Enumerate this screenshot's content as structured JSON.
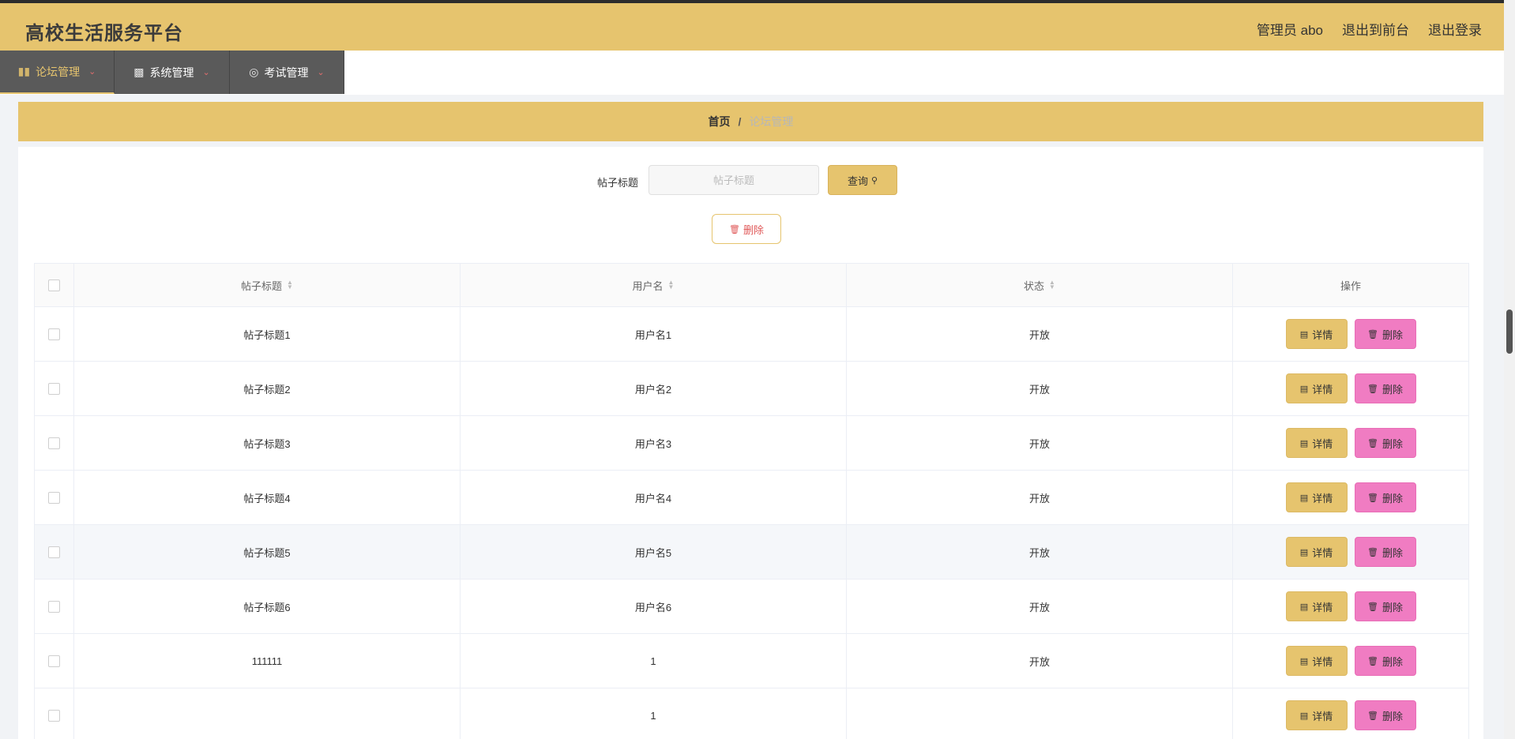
{
  "header": {
    "title": "高校生活服务平台",
    "admin_label": "管理员 abo",
    "to_front": "退出到前台",
    "logout": "退出登录"
  },
  "menu": [
    {
      "label": "论坛管理",
      "icon": "bar-list-icon",
      "active": true
    },
    {
      "label": "系统管理",
      "icon": "bar-chart-icon",
      "active": false
    },
    {
      "label": "考试管理",
      "icon": "compass-icon",
      "active": false
    }
  ],
  "breadcrumb": {
    "home": "首页",
    "separator": "/",
    "current": "论坛管理"
  },
  "search": {
    "label": "帖子标题",
    "placeholder": "帖子标题",
    "value": "",
    "button": "查询"
  },
  "bulk_delete_label": "删除",
  "table": {
    "columns": [
      "帖子标题",
      "用户名",
      "状态",
      "操作"
    ],
    "rows": [
      {
        "title": "帖子标题1",
        "user": "用户名1",
        "status": "开放"
      },
      {
        "title": "帖子标题2",
        "user": "用户名2",
        "status": "开放"
      },
      {
        "title": "帖子标题3",
        "user": "用户名3",
        "status": "开放"
      },
      {
        "title": "帖子标题4",
        "user": "用户名4",
        "status": "开放"
      },
      {
        "title": "帖子标题5",
        "user": "用户名5",
        "status": "开放"
      },
      {
        "title": "帖子标题6",
        "user": "用户名6",
        "status": "开放"
      },
      {
        "title": "111111",
        "user": "1",
        "status": "开放"
      },
      {
        "title": "",
        "user": "1",
        "status": ""
      }
    ],
    "detail_label": "详情",
    "delete_label": "删除"
  },
  "colors": {
    "accent": "#e6c46e",
    "menu_bg": "#5a5a5a",
    "delete_pink": "#f07cc2",
    "danger_text": "#e05a5a"
  }
}
